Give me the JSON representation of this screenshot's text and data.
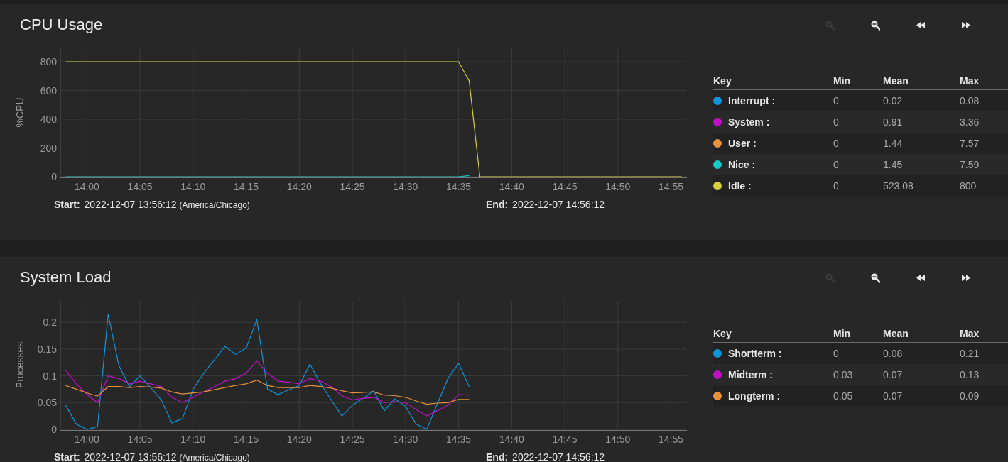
{
  "panels": [
    {
      "title": "CPU Usage",
      "toolbar": [
        {
          "kind": "zoom-in",
          "disabled": true
        },
        {
          "kind": "zoom-out",
          "disabled": false
        },
        {
          "kind": "rewind",
          "disabled": false
        },
        {
          "kind": "forward",
          "disabled": false
        }
      ],
      "chart_data": {
        "type": "line",
        "grid": true,
        "ylabel": "%CPU",
        "ylim": [
          0,
          894
        ],
        "yticks": [
          0,
          200,
          400,
          600,
          800
        ],
        "categories": [
          null,
          null,
          "14:00",
          null,
          null,
          null,
          null,
          "14:05",
          null,
          null,
          null,
          null,
          "14:10",
          null,
          null,
          null,
          null,
          "14:15",
          null,
          null,
          null,
          null,
          "14:20",
          null,
          null,
          null,
          null,
          "14:25",
          null,
          null,
          null,
          null,
          "14:30",
          null,
          null,
          null,
          null,
          "14:35",
          null,
          null,
          null,
          null,
          "14:40",
          null,
          null,
          null,
          null,
          "14:45",
          null,
          null,
          null,
          null,
          "14:50",
          null,
          null,
          null,
          null,
          "14:55",
          null
        ],
        "series": [
          {
            "name": "Interrupt",
            "color": "#0d96d9",
            "values": [
              null,
              null,
              null,
              null,
              null,
              null,
              null,
              null,
              null,
              null,
              null,
              null,
              null,
              null,
              null,
              null,
              null,
              null,
              null,
              null,
              null,
              null,
              null,
              null,
              null,
              null,
              null,
              null,
              null,
              null,
              null,
              null,
              null,
              null,
              null,
              null,
              null,
              null,
              null,
              null,
              null,
              null,
              null,
              null,
              null,
              null,
              null,
              null,
              null,
              null,
              null,
              null,
              null,
              null,
              null,
              null,
              null,
              null,
              null
            ]
          },
          {
            "name": "System",
            "color": "#c40fc9",
            "values": [
              null,
              null,
              null,
              null,
              null,
              null,
              null,
              null,
              null,
              null,
              null,
              null,
              null,
              null,
              null,
              null,
              null,
              null,
              null,
              null,
              null,
              null,
              null,
              null,
              null,
              null,
              null,
              null,
              null,
              null,
              null,
              null,
              null,
              null,
              null,
              null,
              null,
              null,
              null,
              null,
              null,
              null,
              null,
              null,
              null,
              null,
              null,
              null,
              null,
              null,
              null,
              null,
              null,
              null,
              null,
              null,
              null,
              null,
              null
            ]
          },
          {
            "name": "User",
            "color": "#e8913a",
            "values": [
              null,
              null,
              null,
              null,
              null,
              null,
              null,
              null,
              null,
              null,
              null,
              null,
              null,
              null,
              null,
              null,
              null,
              null,
              null,
              null,
              null,
              null,
              null,
              null,
              null,
              null,
              null,
              null,
              null,
              null,
              null,
              null,
              null,
              null,
              null,
              null,
              null,
              null,
              null,
              null,
              null,
              null,
              null,
              null,
              null,
              null,
              null,
              null,
              null,
              null,
              null,
              null,
              null,
              null,
              null,
              null,
              null,
              null,
              null
            ]
          },
          {
            "name": "Nice",
            "color": "#12cccc",
            "values": [
              0,
              0,
              0,
              0,
              0,
              0,
              0,
              0,
              0,
              0,
              0,
              0,
              0,
              0,
              0,
              0,
              0,
              0,
              0,
              0,
              0,
              0,
              0,
              0,
              0,
              0,
              0,
              0,
              0,
              0,
              0,
              0,
              0,
              0,
              0,
              0,
              0,
              0,
              8,
              null,
              null,
              null,
              null,
              null,
              null,
              null,
              null,
              null,
              null,
              null,
              null,
              null,
              null,
              null,
              null,
              null,
              null,
              null,
              null
            ]
          },
          {
            "name": "Idle",
            "color": "#d9cf3c",
            "values": [
              800,
              800,
              800,
              800,
              800,
              800,
              800,
              800,
              800,
              800,
              800,
              800,
              800,
              800,
              800,
              800,
              800,
              800,
              800,
              800,
              800,
              800,
              800,
              800,
              800,
              800,
              800,
              800,
              800,
              800,
              800,
              800,
              800,
              800,
              800,
              800,
              800,
              800,
              667,
              0,
              0,
              0,
              0,
              0,
              0,
              0,
              0,
              0,
              0,
              0,
              0,
              0,
              0,
              0,
              0,
              0,
              0,
              0,
              0
            ]
          }
        ]
      },
      "footer": {
        "start_label": "Start:",
        "start_value": "2022-12-07 13:56:12",
        "timezone": "(America/Chicago)",
        "end_label": "End:",
        "end_value": "2022-12-07 14:56:12"
      },
      "legend": {
        "columns": [
          "Key",
          "Min",
          "Mean",
          "Max"
        ],
        "separator": ":",
        "rows": [
          {
            "min": "0",
            "mean": "0.02",
            "max": "0.08"
          },
          {
            "min": "0",
            "mean": "0.91",
            "max": "3.36"
          },
          {
            "min": "0",
            "mean": "1.44",
            "max": "7.57"
          },
          {
            "min": "0",
            "mean": "1.45",
            "max": "7.59"
          },
          {
            "min": "0",
            "mean": "523.08",
            "max": "800"
          }
        ]
      }
    },
    {
      "title": "System Load",
      "toolbar": [
        {
          "kind": "zoom-in",
          "disabled": true
        },
        {
          "kind": "zoom-out",
          "disabled": false
        },
        {
          "kind": "rewind",
          "disabled": false
        },
        {
          "kind": "forward",
          "disabled": false
        }
      ],
      "chart_data": {
        "type": "line",
        "grid": true,
        "ylabel": "Processes",
        "ylim": [
          0,
          0.24
        ],
        "yticks": [
          0,
          0.05,
          0.1,
          0.15,
          0.2
        ],
        "categories": [
          null,
          null,
          "14:00",
          null,
          null,
          null,
          null,
          "14:05",
          null,
          null,
          null,
          null,
          "14:10",
          null,
          null,
          null,
          null,
          "14:15",
          null,
          null,
          null,
          null,
          "14:20",
          null,
          null,
          null,
          null,
          "14:25",
          null,
          null,
          null,
          null,
          "14:30",
          null,
          null,
          null,
          null,
          "14:35",
          null,
          null,
          null,
          null,
          "14:40",
          null,
          null,
          null,
          null,
          "14:45",
          null,
          null,
          null,
          null,
          "14:50",
          null,
          null,
          null,
          null,
          "14:55",
          null
        ],
        "series": [
          {
            "name": "Shortterm",
            "color": "#0d96d9",
            "values": [
              0.045,
              0.01,
              0,
              0.005,
              0.215,
              0.12,
              0.08,
              0.1,
              0.078,
              0.055,
              0.012,
              0.02,
              0.075,
              0.105,
              0.13,
              0.155,
              0.14,
              0.152,
              0.205,
              0.075,
              0.065,
              0.074,
              0.082,
              0.122,
              0.085,
              0.055,
              0.025,
              0.045,
              0.058,
              0.072,
              0.035,
              0.057,
              0.043,
              0.01,
              0,
              0.048,
              0.095,
              0.123,
              0.08,
              null,
              null,
              null,
              null,
              null,
              null,
              null,
              null,
              null,
              null,
              null,
              null,
              null,
              null,
              null,
              null,
              null,
              null,
              null,
              null
            ]
          },
          {
            "name": "Midterm",
            "color": "#c40fc9",
            "values": [
              0.11,
              0.085,
              0.065,
              0.05,
              0.1,
              0.095,
              0.085,
              0.09,
              0.085,
              0.08,
              0.06,
              0.05,
              0.06,
              0.07,
              0.08,
              0.09,
              0.095,
              0.105,
              0.128,
              0.105,
              0.09,
              0.088,
              0.085,
              0.095,
              0.09,
              0.08,
              0.063,
              0.055,
              0.058,
              0.06,
              0.05,
              0.052,
              0.05,
              0.037,
              0.025,
              0.035,
              0.045,
              0.065,
              0.064,
              null,
              null,
              null,
              null,
              null,
              null,
              null,
              null,
              null,
              null,
              null,
              null,
              null,
              null,
              null,
              null,
              null,
              null,
              null,
              null
            ]
          },
          {
            "name": "Longterm",
            "color": "#e8913a",
            "values": [
              0.082,
              0.075,
              0.068,
              0.062,
              0.08,
              0.08,
              0.078,
              0.08,
              0.079,
              0.077,
              0.07,
              0.066,
              0.068,
              0.07,
              0.074,
              0.078,
              0.082,
              0.085,
              0.092,
              0.082,
              0.078,
              0.078,
              0.078,
              0.082,
              0.08,
              0.077,
              0.072,
              0.068,
              0.069,
              0.07,
              0.064,
              0.063,
              0.06,
              0.053,
              0.047,
              0.049,
              0.05,
              0.056,
              0.056,
              null,
              null,
              null,
              null,
              null,
              null,
              null,
              null,
              null,
              null,
              null,
              null,
              null,
              null,
              null,
              null,
              null,
              null,
              null,
              null
            ]
          }
        ]
      },
      "footer": {
        "start_label": "Start:",
        "start_value": "2022-12-07 13:56:12",
        "timezone": "(America/Chicago)",
        "end_label": "End:",
        "end_value": "2022-12-07 14:56:12"
      },
      "legend": {
        "columns": [
          "Key",
          "Min",
          "Mean",
          "Max"
        ],
        "separator": ":",
        "rows": [
          {
            "min": "0",
            "mean": "0.08",
            "max": "0.21"
          },
          {
            "min": "0.03",
            "mean": "0.07",
            "max": "0.13"
          },
          {
            "min": "0.05",
            "mean": "0.07",
            "max": "0.09"
          }
        ]
      }
    }
  ]
}
